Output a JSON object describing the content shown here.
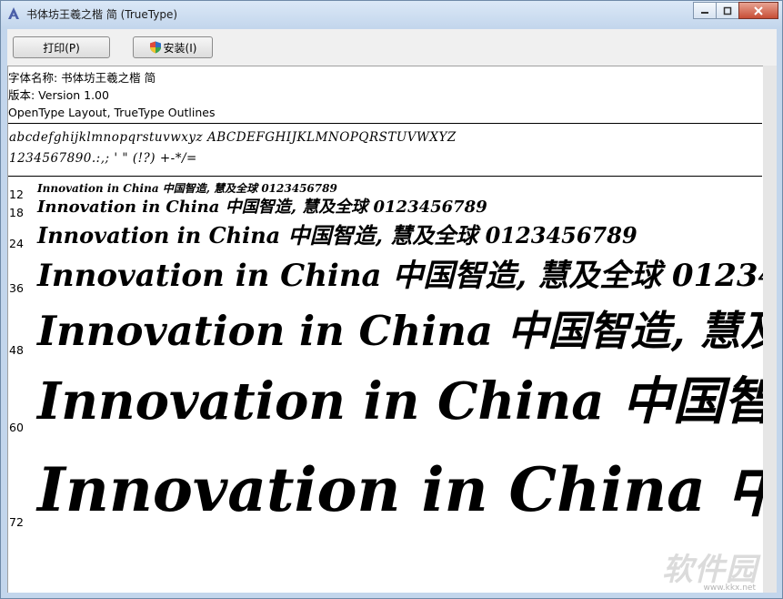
{
  "window": {
    "title": "书体坊王羲之楷 简 (TrueType)"
  },
  "toolbar": {
    "print_label": "打印(P)",
    "install_label": "安装(I)"
  },
  "font_info": {
    "name_line": "字体名称: 书体坊王羲之楷 简",
    "version_line": "版本: Version 1.00",
    "tech_line": "OpenType Layout, TrueType Outlines"
  },
  "charset": {
    "line1": "abcdefghijklmnopqrstuvwxyz ABCDEFGHIJKLMNOPQRSTUVWXYZ",
    "line2": "1234567890.:,; ' \" (!?) +-*/="
  },
  "sample_text": "Innovation in China 中国智造, 慧及全球 0123456789",
  "sizes": [
    {
      "size": "12",
      "pt": 12
    },
    {
      "size": "18",
      "pt": 18
    },
    {
      "size": "24",
      "pt": 24
    },
    {
      "size": "36",
      "pt": 36
    },
    {
      "size": "48",
      "pt": 48
    },
    {
      "size": "60",
      "pt": 60
    },
    {
      "size": "72",
      "pt": 72
    }
  ],
  "watermark": {
    "text": "软件园",
    "url": "www.kkx.net"
  }
}
